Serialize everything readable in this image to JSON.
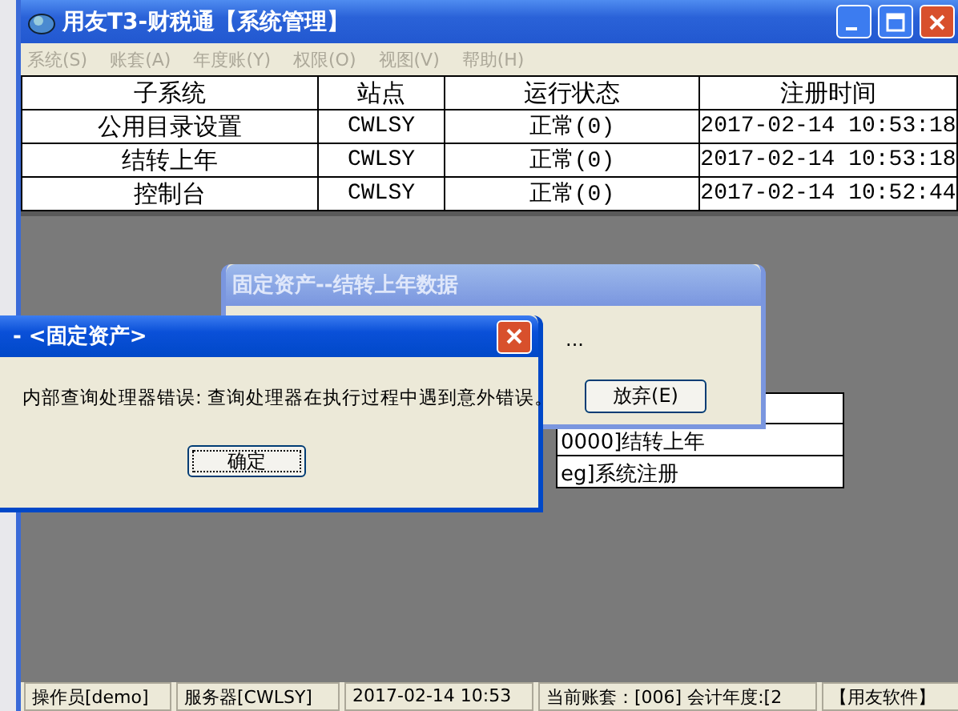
{
  "window": {
    "title": "用友T3-财税通【系统管理】"
  },
  "menu": [
    {
      "label": "系统(S)",
      "disabled": true
    },
    {
      "label": "账套(A)",
      "disabled": true
    },
    {
      "label": "年度账(Y)",
      "disabled": true
    },
    {
      "label": "权限(O)",
      "disabled": true
    },
    {
      "label": "视图(V)",
      "disabled": true
    },
    {
      "label": "帮助(H)",
      "disabled": true
    }
  ],
  "table": {
    "columns": [
      "子系统",
      "站点",
      "运行状态",
      "注册时间"
    ],
    "rows": [
      [
        "公用目录设置",
        "CWLSY",
        "正常(0)",
        "2017-02-14 10:53:18"
      ],
      [
        "结转上年",
        "CWLSY",
        "正常(0)",
        "2017-02-14 10:53:18"
      ],
      [
        "控制台",
        "CWLSY",
        "正常(0)",
        "2017-02-14 10:52:44"
      ]
    ]
  },
  "background_list": [
    "0000]结转上年",
    "eg]系统注册"
  ],
  "progress_dialog": {
    "title": "固定资产--结转上年数据",
    "message": "...",
    "buttons": [
      "放弃(E)"
    ]
  },
  "error_dialog": {
    "title": "- <固定资产>",
    "message": "内部查询处理器错误: 查询处理器在执行过程中遇到意外错误。",
    "buttons": [
      "确定"
    ]
  },
  "status_bar": [
    "操作员[demo]",
    "服务器[CWLSY]",
    "2017-02-14 10:53",
    "当前账套：[006] 会计年度:[2",
    "【用友软件】"
  ]
}
